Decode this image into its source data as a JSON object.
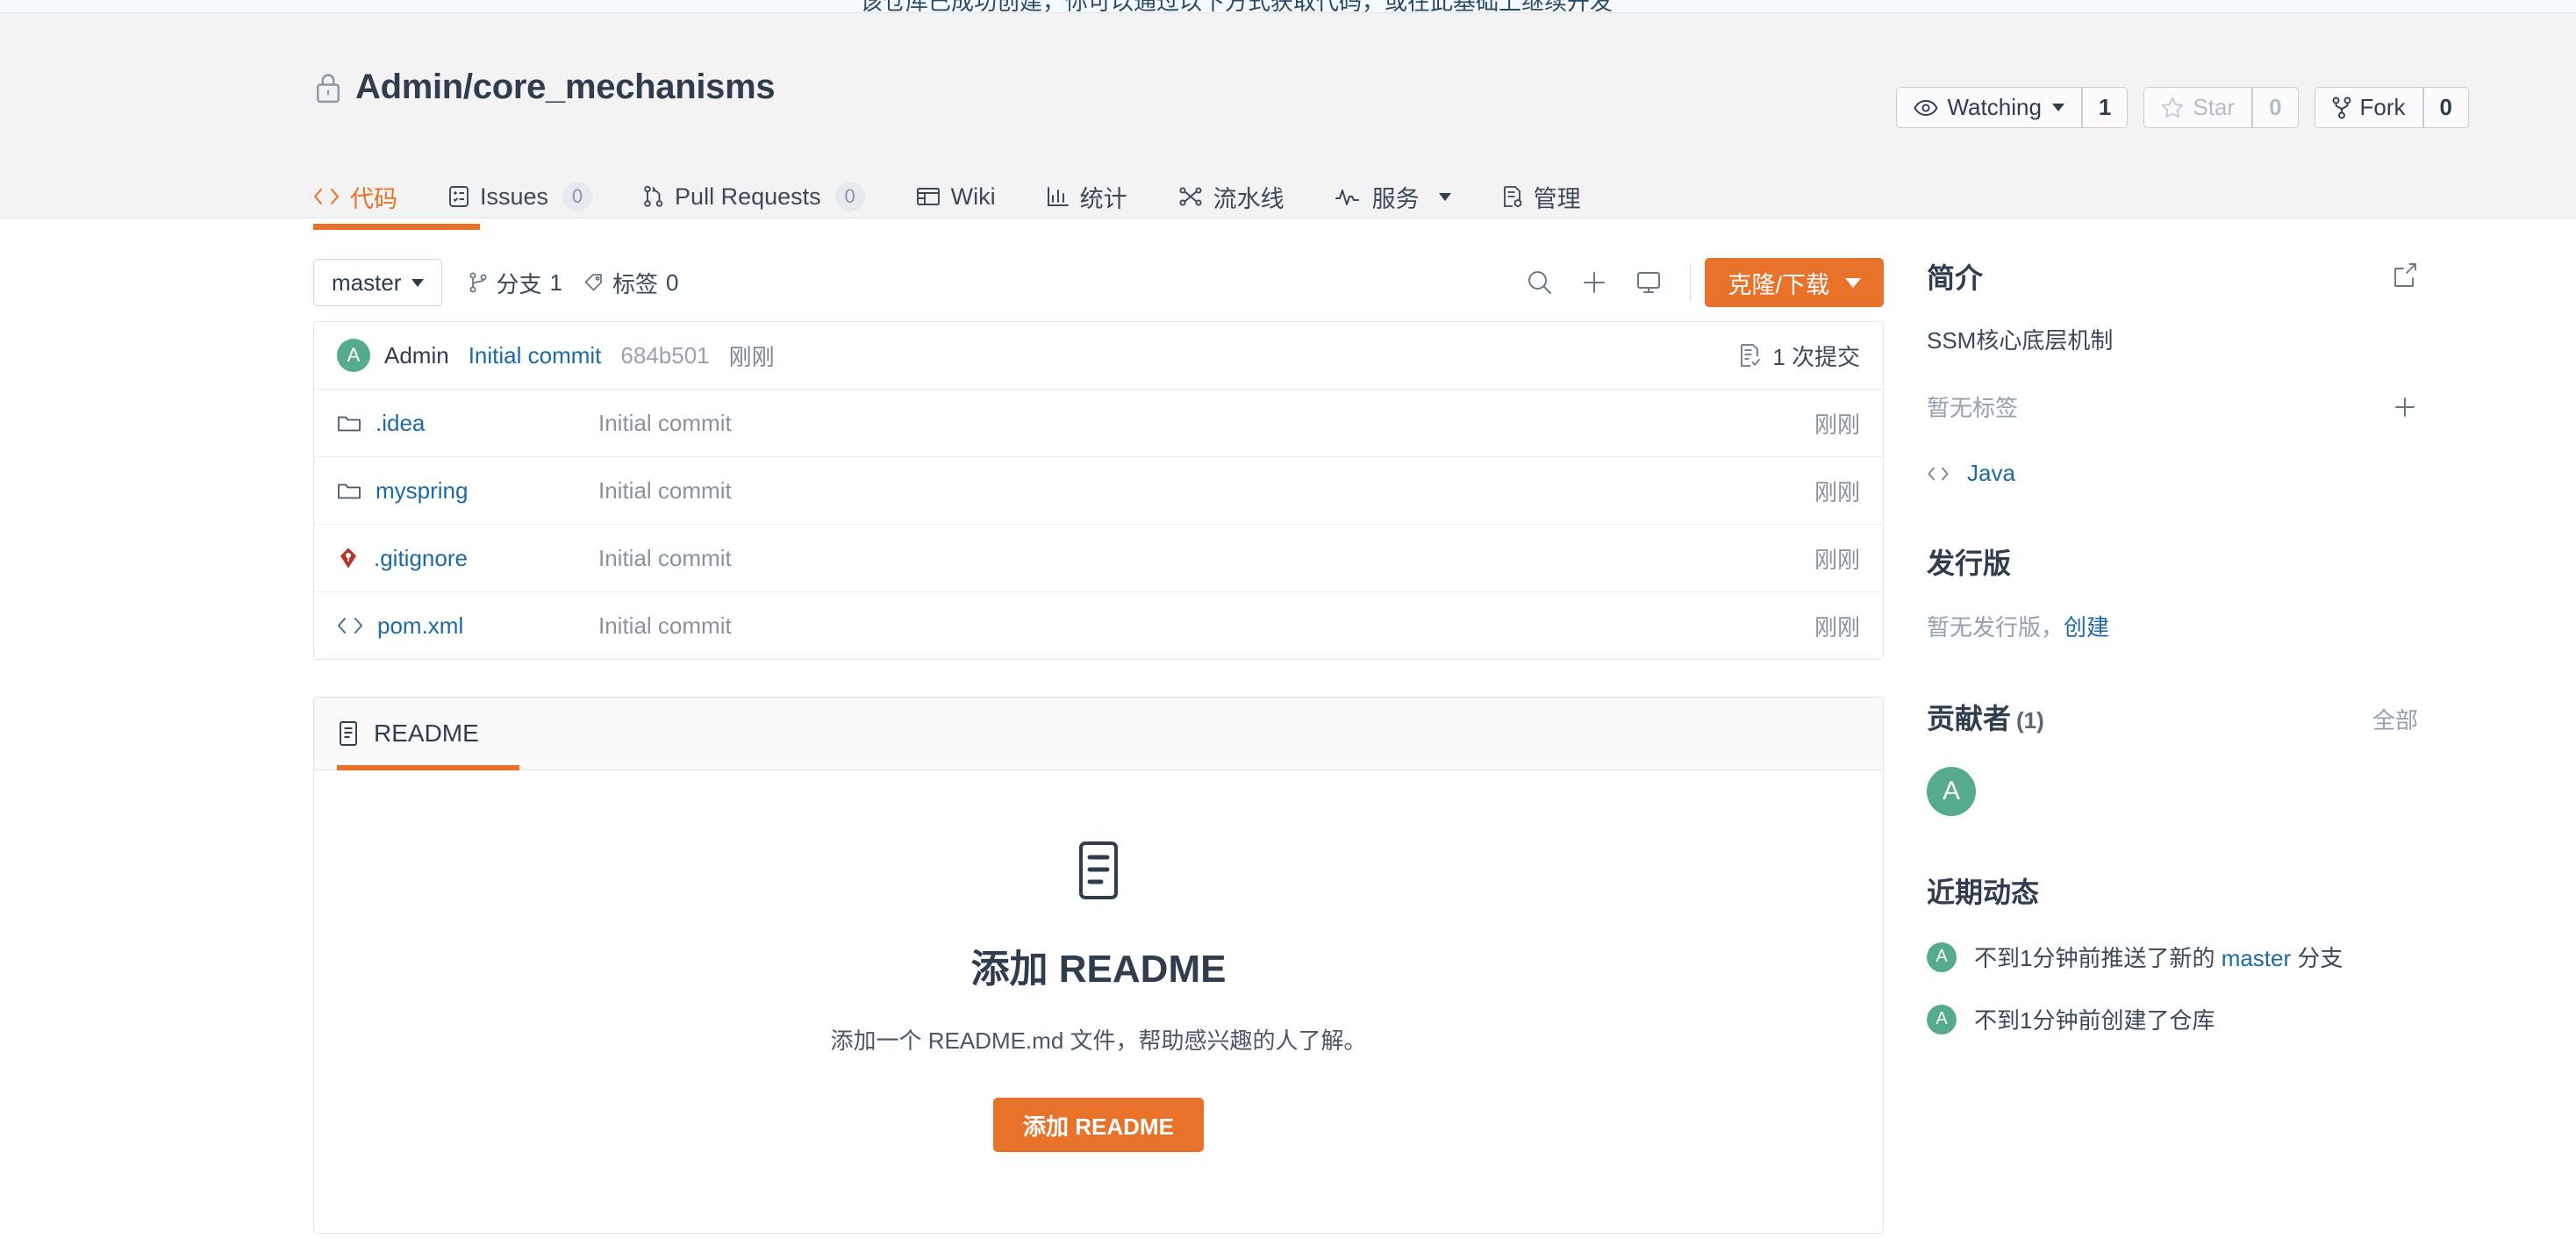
{
  "top_banner": {
    "cut_text": "该仓库已成功创建，你可以通过以下方式获取代码，或在此基础上继续开发"
  },
  "repo": {
    "title": "Admin/core_mechanisms",
    "lock_icon": "lock-icon",
    "visibility": "private"
  },
  "repo_actions": {
    "watching": {
      "label": "Watching",
      "count": "1",
      "icon": "eye-icon"
    },
    "star": {
      "label": "Star",
      "count": "0",
      "icon": "star-icon"
    },
    "fork": {
      "label": "Fork",
      "count": "0",
      "icon": "fork-icon"
    }
  },
  "nav_tabs": [
    {
      "label": "代码",
      "icon": "code-icon",
      "badge": null,
      "active": true
    },
    {
      "label": "Issues",
      "icon": "issue-icon",
      "badge": "0",
      "active": false
    },
    {
      "label": "Pull Requests",
      "icon": "pull-request-icon",
      "badge": "0",
      "active": false
    },
    {
      "label": "Wiki",
      "icon": "book-icon",
      "badge": null,
      "active": false
    },
    {
      "label": "统计",
      "icon": "chart-icon",
      "badge": null,
      "active": false
    },
    {
      "label": "流水线",
      "icon": "pipeline-icon",
      "badge": null,
      "active": false
    },
    {
      "label": "服务",
      "icon": "activity-icon",
      "badge": null,
      "active": false,
      "has_caret": true
    },
    {
      "label": "管理",
      "icon": "settings-doc-icon",
      "badge": null,
      "active": false
    }
  ],
  "toolbar": {
    "branch_selected": "master",
    "branches_label": "分支",
    "branches_count": "1",
    "tags_label": "标签",
    "tags_count": "0",
    "search_icon": "search-icon",
    "add_icon": "plus-icon",
    "desktop_icon": "monitor-icon",
    "clone_label": "克隆/下载"
  },
  "commit_bar": {
    "avatar_initial": "A",
    "author": "Admin",
    "message": "Initial commit",
    "sha": "684b501",
    "time": "刚刚",
    "commits_label": "1 次提交",
    "commits_icon": "commit-list-icon"
  },
  "files": [
    {
      "name": ".idea",
      "icon": "folder-icon",
      "commit": "Initial commit",
      "time": "刚刚"
    },
    {
      "name": "myspring",
      "icon": "folder-icon",
      "commit": "Initial commit",
      "time": "刚刚"
    },
    {
      "name": ".gitignore",
      "icon": "gitignore-icon",
      "commit": "Initial commit",
      "time": "刚刚"
    },
    {
      "name": "pom.xml",
      "icon": "xml-file-icon",
      "commit": "Initial commit",
      "time": "刚刚"
    }
  ],
  "readme": {
    "tab_label": "README",
    "tab_icon": "readme-icon",
    "empty_icon": "readme-big-icon",
    "heading": "添加 README",
    "description": "添加一个 README.md 文件，帮助感兴趣的人了解。",
    "button_label": "添加 README"
  },
  "sidebar": {
    "about": {
      "title": "简介",
      "edit_icon": "edit-icon",
      "description": "SSM核心底层机制",
      "no_tags": "暂无标签",
      "add_tag_icon": "plus-icon",
      "language": "Java",
      "language_icon": "code-icon"
    },
    "releases": {
      "title": "发行版",
      "empty_text": "暂无发行版，",
      "create_link": "创建"
    },
    "contributors": {
      "title": "贡献者",
      "count": "(1)",
      "all_link": "全部",
      "avatars": [
        {
          "initial": "A"
        }
      ]
    },
    "activity": {
      "title": "近期动态",
      "items": [
        {
          "avatar_initial": "A",
          "prefix": "不到1分钟前推送了新的 ",
          "link": "master",
          "suffix": " 分支"
        },
        {
          "avatar_initial": "A",
          "prefix": "不到1分钟前创建了仓库",
          "link": "",
          "suffix": ""
        }
      ]
    }
  },
  "colors": {
    "accent_orange": "#e8722a",
    "link_blue": "#1b6aa5",
    "text_dark": "#2f3d4f",
    "muted": "#8a929d",
    "avatar_green": "#56ab8f",
    "header_bg": "#f3f3f4",
    "banner_bg": "#f4fafe"
  }
}
